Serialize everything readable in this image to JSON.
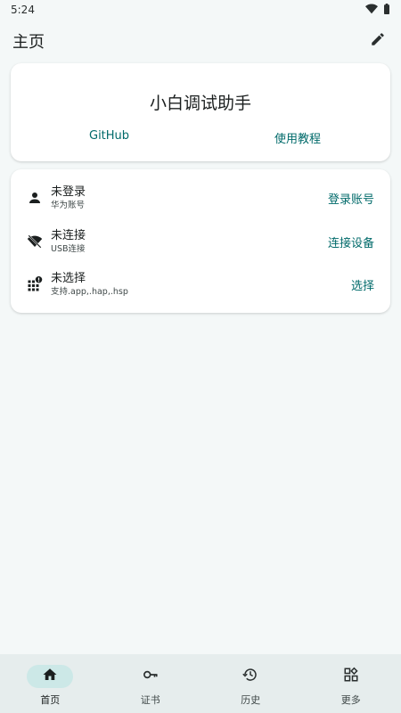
{
  "status_bar": {
    "time": "5:24",
    "icons": [
      "wifi-icon",
      "battery-icon"
    ]
  },
  "app_bar": {
    "title": "主页",
    "action_icon": "edit-icon"
  },
  "app_card": {
    "title": "小白调试助手",
    "links": {
      "github": "GitHub",
      "tutorial": "使用教程"
    }
  },
  "status_list": {
    "rows": [
      {
        "icon": "person-icon",
        "title": "未登录",
        "subtitle": "华为账号",
        "action": "登录账号"
      },
      {
        "icon": "wifi-off-icon",
        "title": "未连接",
        "subtitle": "USB连接",
        "action": "连接设备"
      },
      {
        "icon": "apps-alert-icon",
        "title": "未选择",
        "subtitle": "支持.app,.hap,.hsp",
        "action": "选择"
      }
    ]
  },
  "bottom_nav": {
    "items": [
      {
        "label": "首页",
        "icon": "home-icon",
        "active": true
      },
      {
        "label": "证书",
        "icon": "key-icon",
        "active": false
      },
      {
        "label": "历史",
        "icon": "history-icon",
        "active": false
      },
      {
        "label": "更多",
        "icon": "grid-more-icon",
        "active": false
      }
    ]
  },
  "colors": {
    "accent": "#006a6a",
    "background": "#f4f8f8",
    "nav_background": "#e6eded",
    "nav_active_pill": "#cce8e7"
  }
}
